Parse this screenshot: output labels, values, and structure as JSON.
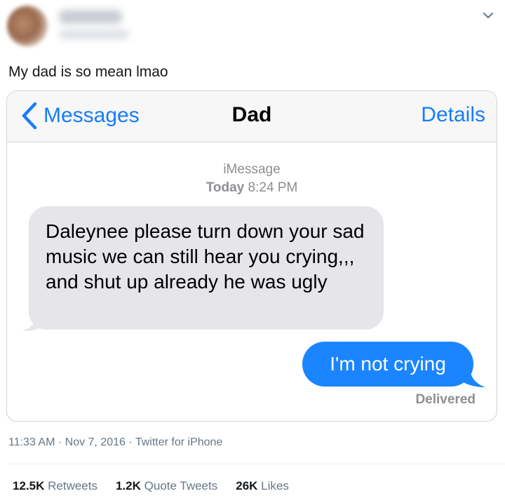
{
  "tweet": {
    "text": "My dad is so mean lmao",
    "timestamp": "11:33 AM · Nov 7, 2016 · Twitter for iPhone",
    "stats": {
      "retweets_count": "12.5K",
      "retweets_label": "Retweets",
      "quotes_count": "1.2K",
      "quotes_label": "Quote Tweets",
      "likes_count": "26K",
      "likes_label": "Likes"
    }
  },
  "screenshot": {
    "nav": {
      "back_label": "Messages",
      "title": "Dad",
      "details_label": "Details"
    },
    "meta": {
      "service": "iMessage",
      "day": "Today",
      "time": "8:24 PM"
    },
    "messages": [
      {
        "direction": "incoming",
        "text": "Daleynee please turn down your sad music we can still hear you crying,,, and shut up already he was ugly"
      },
      {
        "direction": "outgoing",
        "text": "I'm not crying"
      }
    ],
    "status": "Delivered"
  },
  "colors": {
    "imessage_blue": "#1a85ff",
    "ios_link_blue": "#147efb",
    "incoming_bubble": "#e5e5ea"
  }
}
